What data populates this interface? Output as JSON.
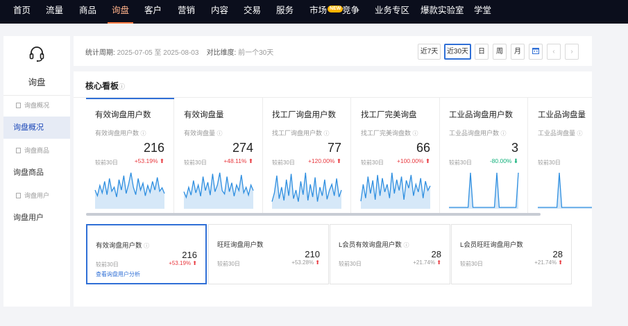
{
  "nav": {
    "items": [
      "首页",
      "流量",
      "商品",
      "询盘",
      "客户",
      "营销",
      "内容",
      "交易",
      "服务",
      "市场",
      "竞争",
      "业务专区",
      "爆款实验室",
      "学堂"
    ],
    "active_index": 3,
    "new_badge": "NEW"
  },
  "sidebar": {
    "title": "询盘",
    "icon": "headset-icon",
    "items": [
      {
        "label": "询盘概况",
        "type": "sub"
      },
      {
        "label": "询盘概况",
        "type": "main",
        "active": true
      },
      {
        "label": "询盘商品",
        "type": "sub"
      },
      {
        "label": "询盘商品",
        "type": "main"
      },
      {
        "label": "询盘用户",
        "type": "sub"
      },
      {
        "label": "询盘用户",
        "type": "main"
      }
    ]
  },
  "statbar": {
    "period_label": "统计周期:",
    "period_value": "2025-07-05 至 2025-08-03",
    "compare_label": "对比维度:",
    "compare_value": "前一个30天",
    "buttons": [
      "近7天",
      "近30天",
      "日",
      "周",
      "月"
    ],
    "active_button": "近30天",
    "calendar_icon": "calendar-icon",
    "prev_icon": "chevron-left-icon",
    "next_icon": "chevron-right-icon"
  },
  "board": {
    "title": "核心看板",
    "help_icon": "question-circle-icon",
    "compare_label": "较前30日",
    "tiles": [
      {
        "title": "有效询盘用户数",
        "sub": "有效询盘用户数",
        "value": "216",
        "change": "+53.19%",
        "dir": "up",
        "spark": [
          30,
          20,
          38,
          25,
          45,
          22,
          50,
          28,
          35,
          18,
          48,
          30,
          55,
          24,
          40,
          60,
          35,
          22,
          50,
          30,
          42,
          20,
          38,
          26,
          45,
          30,
          52,
          28,
          34,
          24
        ]
      },
      {
        "title": "有效询盘量",
        "sub": "有效询盘量",
        "value": "274",
        "change": "+48.11%",
        "dir": "up",
        "spark": [
          28,
          18,
          36,
          22,
          48,
          26,
          40,
          20,
          55,
          30,
          45,
          22,
          60,
          28,
          40,
          62,
          30,
          24,
          55,
          28,
          44,
          20,
          40,
          30,
          58,
          26,
          36,
          22,
          40,
          30
        ]
      },
      {
        "title": "找工厂询盘用户数",
        "sub": "找工厂询盘用户数",
        "value": "77",
        "change": "+120.00%",
        "dir": "up",
        "spark": [
          10,
          25,
          55,
          15,
          35,
          12,
          48,
          20,
          58,
          15,
          30,
          10,
          45,
          22,
          60,
          12,
          40,
          18,
          52,
          10,
          35,
          20,
          48,
          14,
          30,
          40,
          20,
          50,
          18,
          30
        ]
      },
      {
        "title": "找工厂完美询盘",
        "sub": "找工厂完美询盘数",
        "value": "66",
        "change": "+100.00%",
        "dir": "up",
        "spark": [
          8,
          30,
          12,
          40,
          18,
          35,
          10,
          42,
          15,
          38,
          20,
          30,
          12,
          45,
          18,
          36,
          22,
          40,
          10,
          35,
          25,
          42,
          15,
          30,
          20,
          38,
          12,
          34,
          22,
          28
        ]
      },
      {
        "title": "工业品询盘用户数",
        "sub": "工业品询盘用户数",
        "value": "3",
        "change": "-80.00%",
        "dir": "down",
        "spark": [
          0,
          0,
          0,
          0,
          0,
          0,
          0,
          0,
          0,
          100,
          0,
          0,
          0,
          0,
          0,
          0,
          0,
          0,
          0,
          0,
          100,
          0,
          0,
          0,
          0,
          0,
          0,
          0,
          0,
          100
        ]
      },
      {
        "title": "工业品询盘量",
        "sub": "工业品询盘量",
        "value": "",
        "change": "",
        "dir": "up",
        "spark": [
          0,
          0,
          0,
          0,
          0,
          0,
          0,
          0,
          0,
          100,
          0,
          0,
          0,
          0,
          0,
          0,
          0,
          0,
          0,
          0,
          0,
          0,
          0,
          0,
          0,
          0,
          0,
          0,
          0,
          0
        ]
      }
    ],
    "cards": [
      {
        "title": "有效询盘用户数",
        "value": "216",
        "change": "+53.19%",
        "dir": "up",
        "link": "查看询盘用户分析",
        "active": true,
        "help": true
      },
      {
        "title": "旺旺询盘用户数",
        "value": "210",
        "change": "+53.28%",
        "dir": "up",
        "active": false,
        "help": false
      },
      {
        "title": "L会员有效询盘用户数",
        "value": "28",
        "change": "+21.74%",
        "dir": "up",
        "active": false,
        "help": true
      },
      {
        "title": "L会员旺旺询盘用户数",
        "value": "28",
        "change": "+21.74%",
        "dir": "up",
        "active": false,
        "help": false
      }
    ]
  },
  "colors": {
    "accent": "#2f6fd6",
    "nav_bg": "#0b0e1c",
    "up": "#e8373d",
    "down": "#10b07a",
    "line": "#2f8fe0",
    "area": "#d6e8f8"
  }
}
